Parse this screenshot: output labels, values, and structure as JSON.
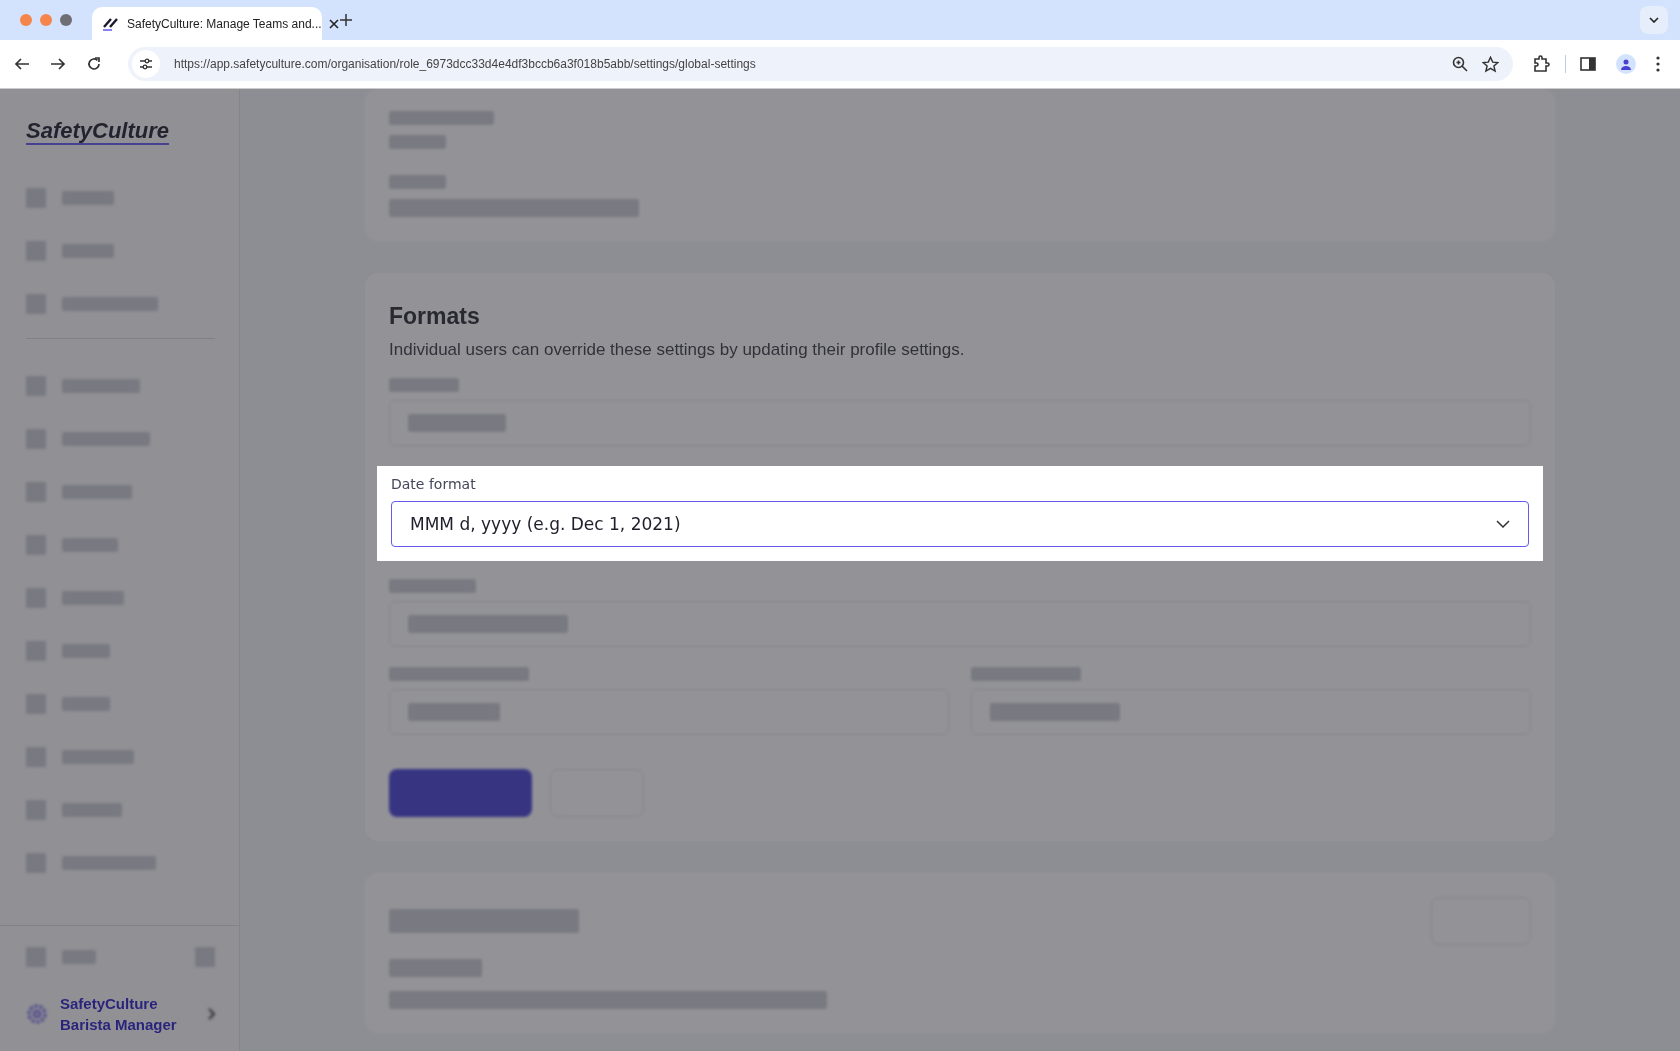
{
  "browser": {
    "tab_title": "SafetyCulture: Manage Teams and...",
    "url": "https://app.safetyculture.com/organisation/role_6973dcc33d4e4df3bccb6a3f018b5abb/settings/global-settings"
  },
  "sidebar": {
    "logo": "SafetyCulture",
    "account": {
      "line_1": "SafetyCulture",
      "line_2": "Barista Manager"
    }
  },
  "formats": {
    "title": "Formats",
    "description": "Individual users can override these settings by updating their profile settings.",
    "date_format": {
      "label": "Date format",
      "value": "MMM d, yyyy (e.g. Dec 1, 2021)"
    }
  }
}
